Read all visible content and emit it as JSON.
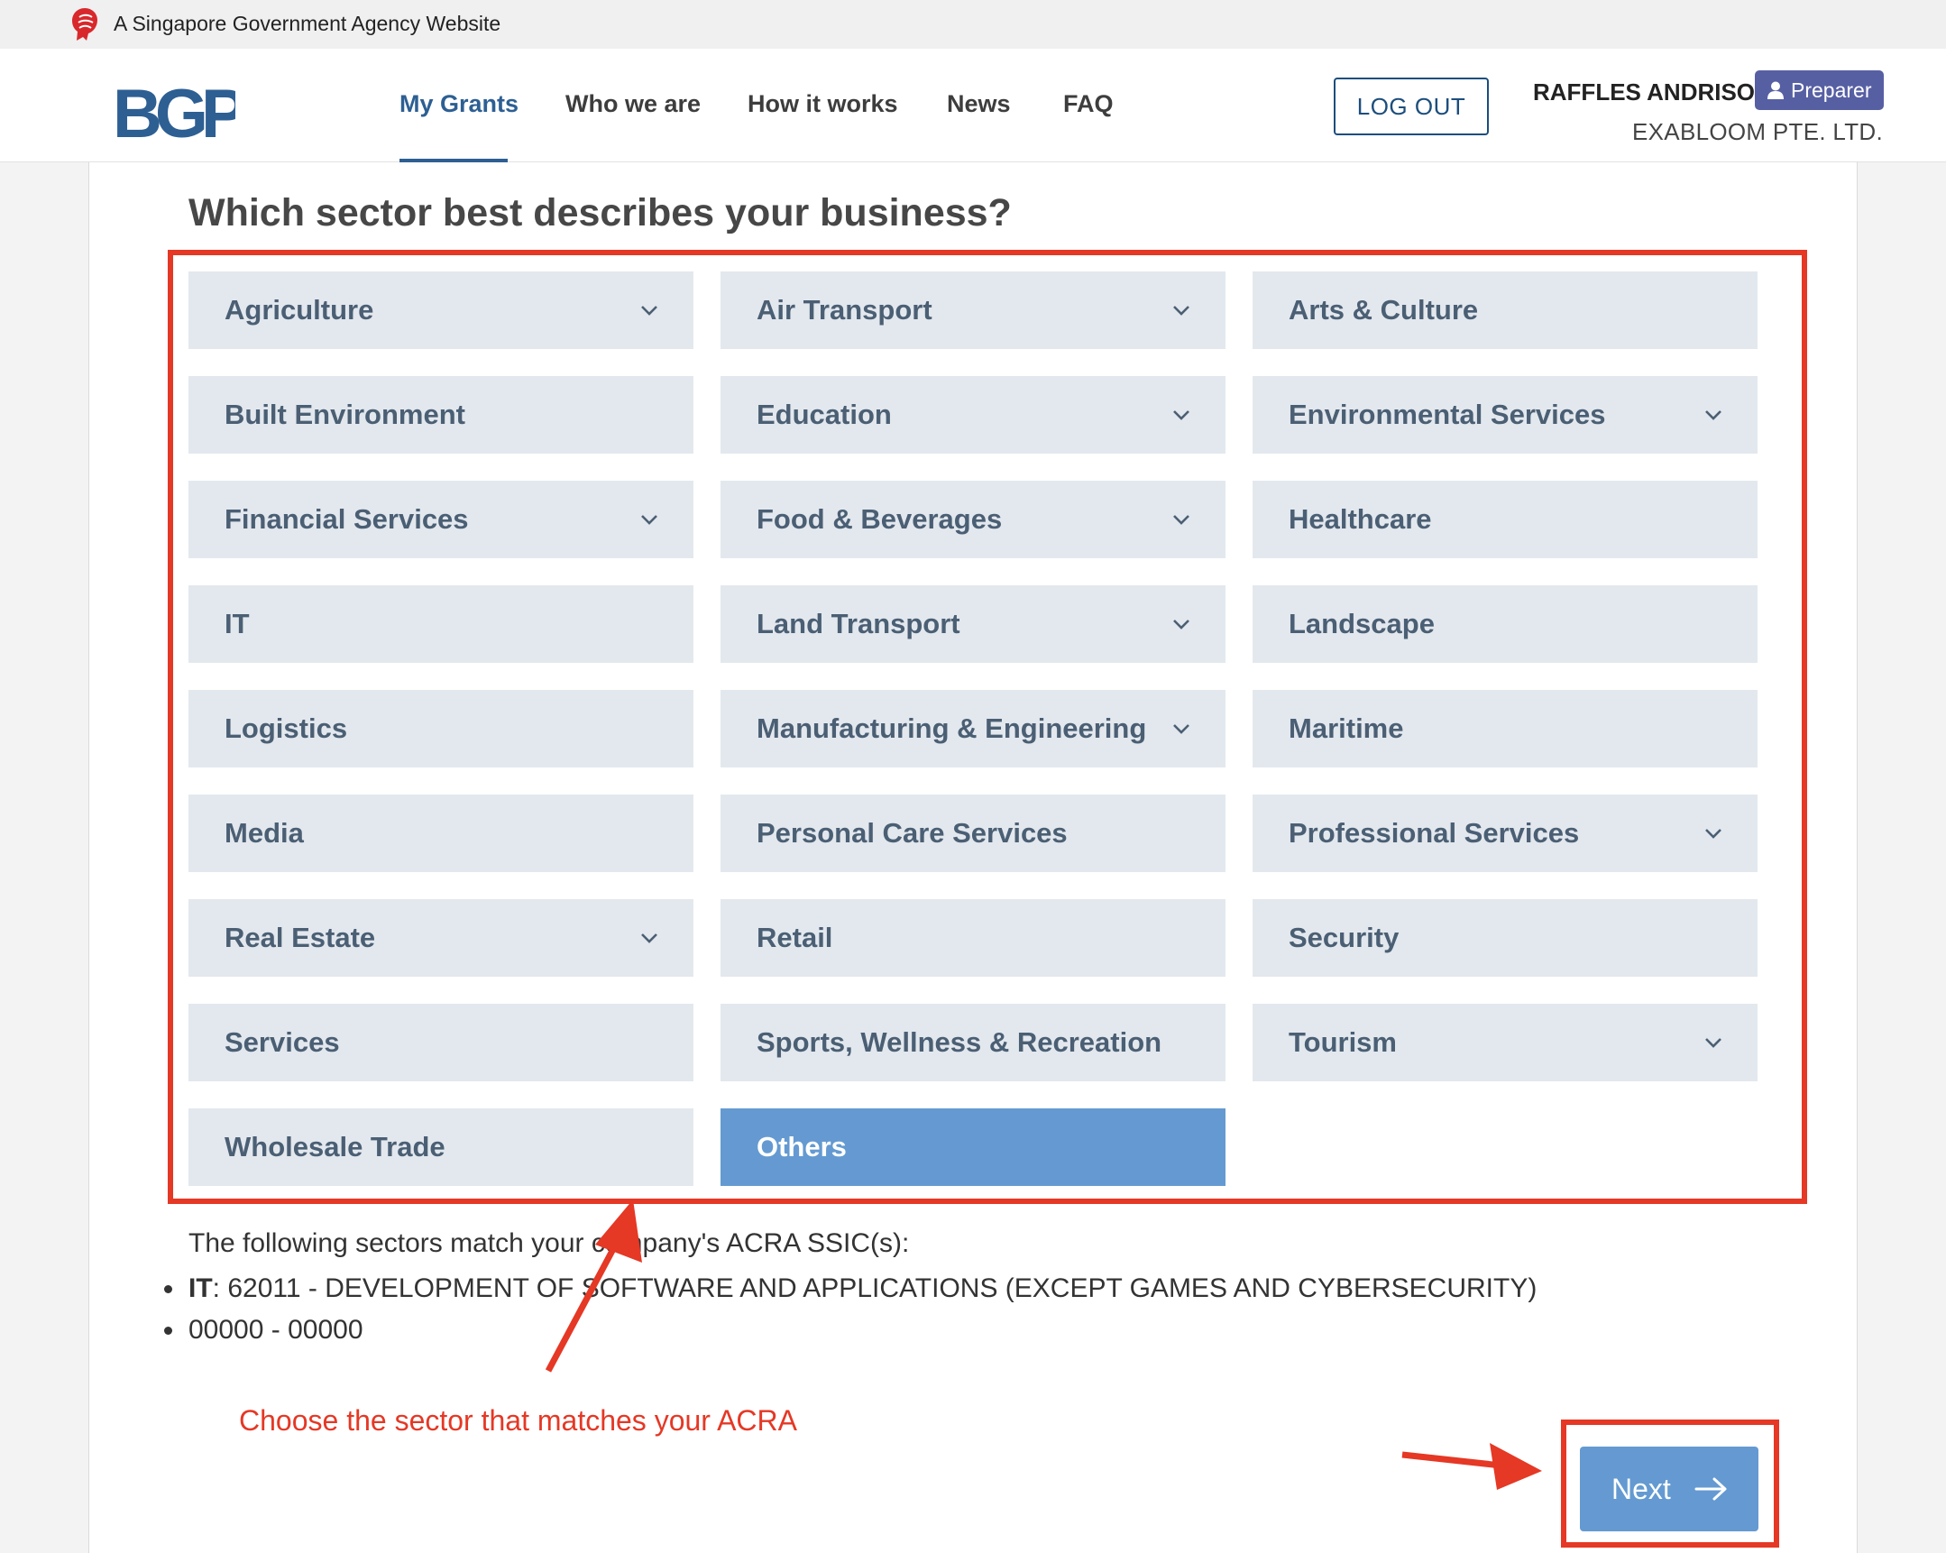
{
  "masthead": {
    "text": "A Singapore Government Agency Website",
    "icon": "lion-head-icon"
  },
  "header": {
    "logo_text": "BGP",
    "nav": [
      {
        "label": "My Grants",
        "active": true
      },
      {
        "label": "Who we are",
        "active": false
      },
      {
        "label": "How it works",
        "active": false
      },
      {
        "label": "News",
        "active": false
      },
      {
        "label": "FAQ",
        "active": false
      }
    ],
    "logout_label": "LOG OUT",
    "user_name": "RAFFLES ANDRISON",
    "role_label": "Preparer",
    "company": "EXABLOOM PTE. LTD."
  },
  "form": {
    "question": "Which sector best describes your business?",
    "sectors": [
      {
        "label": "Agriculture",
        "dropdown": true,
        "selected": false
      },
      {
        "label": "Air Transport",
        "dropdown": true,
        "selected": false
      },
      {
        "label": "Arts & Culture",
        "dropdown": false,
        "selected": false
      },
      {
        "label": "Built Environment",
        "dropdown": false,
        "selected": false
      },
      {
        "label": "Education",
        "dropdown": true,
        "selected": false
      },
      {
        "label": "Environmental Services",
        "dropdown": true,
        "selected": false
      },
      {
        "label": "Financial Services",
        "dropdown": true,
        "selected": false
      },
      {
        "label": "Food & Beverages",
        "dropdown": true,
        "selected": false
      },
      {
        "label": "Healthcare",
        "dropdown": false,
        "selected": false
      },
      {
        "label": "IT",
        "dropdown": false,
        "selected": false
      },
      {
        "label": "Land Transport",
        "dropdown": true,
        "selected": false
      },
      {
        "label": "Landscape",
        "dropdown": false,
        "selected": false
      },
      {
        "label": "Logistics",
        "dropdown": false,
        "selected": false
      },
      {
        "label": "Manufacturing & Engineering",
        "dropdown": true,
        "selected": false
      },
      {
        "label": "Maritime",
        "dropdown": false,
        "selected": false
      },
      {
        "label": "Media",
        "dropdown": false,
        "selected": false
      },
      {
        "label": "Personal Care Services",
        "dropdown": false,
        "selected": false
      },
      {
        "label": "Professional Services",
        "dropdown": true,
        "selected": false
      },
      {
        "label": "Real Estate",
        "dropdown": true,
        "selected": false
      },
      {
        "label": "Retail",
        "dropdown": false,
        "selected": false
      },
      {
        "label": "Security",
        "dropdown": false,
        "selected": false
      },
      {
        "label": "Services",
        "dropdown": false,
        "selected": false
      },
      {
        "label": "Sports, Wellness & Recreation",
        "dropdown": false,
        "selected": false
      },
      {
        "label": "Tourism",
        "dropdown": true,
        "selected": false
      },
      {
        "label": "Wholesale Trade",
        "dropdown": false,
        "selected": false
      },
      {
        "label": "Others",
        "dropdown": false,
        "selected": true
      }
    ],
    "acra_intro": "The following sectors match your company's ACRA SSIC(s):",
    "acra_matches": [
      {
        "sector": "IT",
        "code": "62011 - DEVELOPMENT OF SOFTWARE AND APPLICATIONS (EXCEPT GAMES AND CYBERSECURITY)"
      },
      {
        "sector": "",
        "code": "00000 - 00000"
      }
    ],
    "next_label": "Next"
  },
  "annotation": {
    "text": "Choose the sector that matches your ACRA"
  },
  "colors": {
    "primary": "#2d5f93",
    "selected_tile": "#649ad1",
    "tile": "#e3e8ee",
    "tile_text": "#4b5f74",
    "annotation": "#e53825",
    "badge": "#575fa3"
  }
}
